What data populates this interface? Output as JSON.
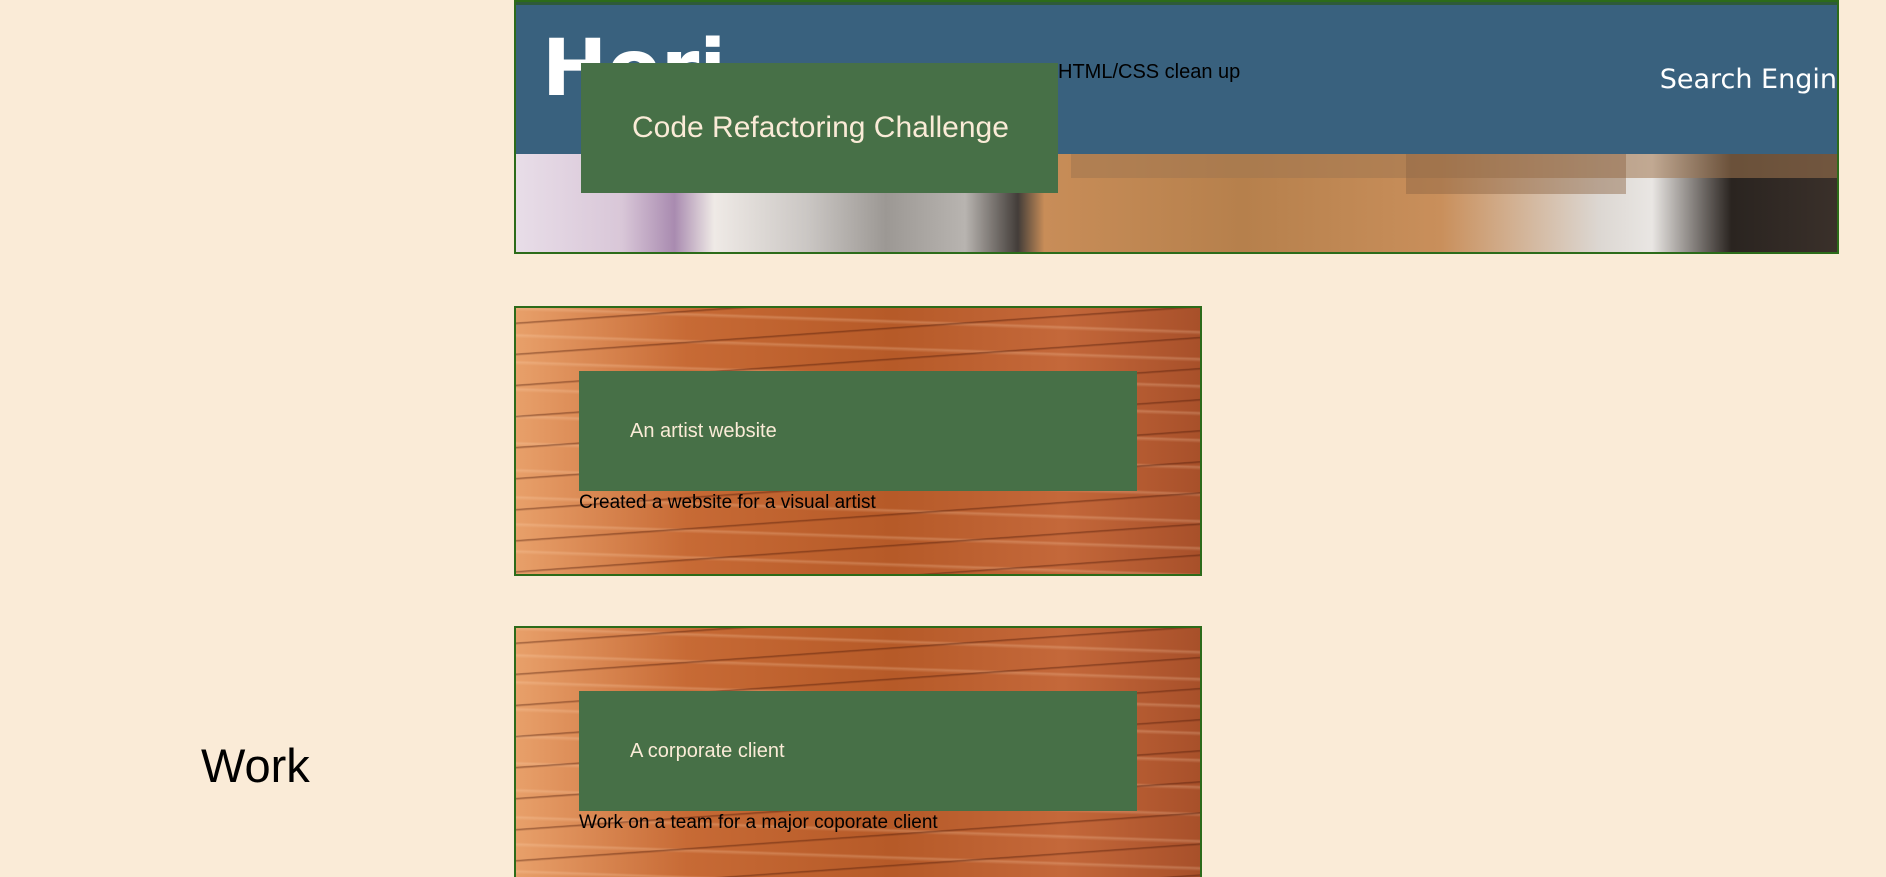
{
  "sidebar": {
    "heading": "Work"
  },
  "hero": {
    "banner_word": "Hori",
    "banner_right": "Search Engin",
    "title": "Code Refactoring Challenge",
    "subtitle": "HTML/CSS clean up"
  },
  "projects": [
    {
      "title": "An artist website",
      "description": "Created a website for a visual artist"
    },
    {
      "title": "A corporate client",
      "description": "Work on a team for a major coporate client"
    }
  ],
  "colors": {
    "page_background": "#faebd7",
    "title_box": "#477047",
    "title_text": "#faebd7",
    "card_border": "#2c6b1a",
    "banner": "#39617e"
  }
}
